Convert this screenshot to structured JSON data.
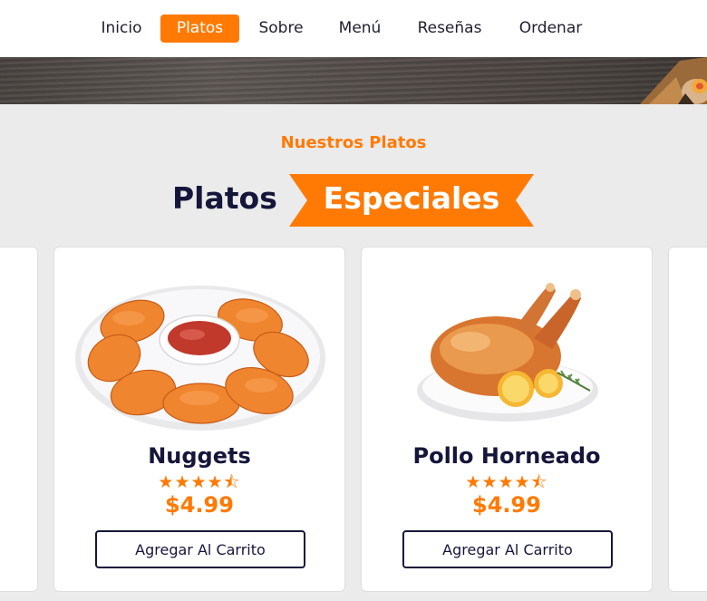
{
  "nav": {
    "items": [
      {
        "label": "Inicio",
        "active": false
      },
      {
        "label": "Platos",
        "active": true
      },
      {
        "label": "Sobre",
        "active": false
      },
      {
        "label": "Menú",
        "active": false
      },
      {
        "label": "Reseñas",
        "active": false
      },
      {
        "label": "Ordenar",
        "active": false
      }
    ]
  },
  "section": {
    "subtitle": "Nuestros Platos",
    "title_dark": "Platos",
    "title_highlight": "Especiales"
  },
  "dishes": [
    {
      "name": "Nuggets",
      "rating": 4.5,
      "price": "$4.99",
      "button": "Agregar Al Carrito",
      "image_icon": "nuggets-image"
    },
    {
      "name": "Pollo Horneado",
      "rating": 4.5,
      "price": "$4.99",
      "button": "Agregar Al Carrito",
      "image_icon": "roast-chicken-image"
    }
  ],
  "colors": {
    "accent": "#ff7a05",
    "dark": "#15163a",
    "background": "#ebebeb"
  }
}
